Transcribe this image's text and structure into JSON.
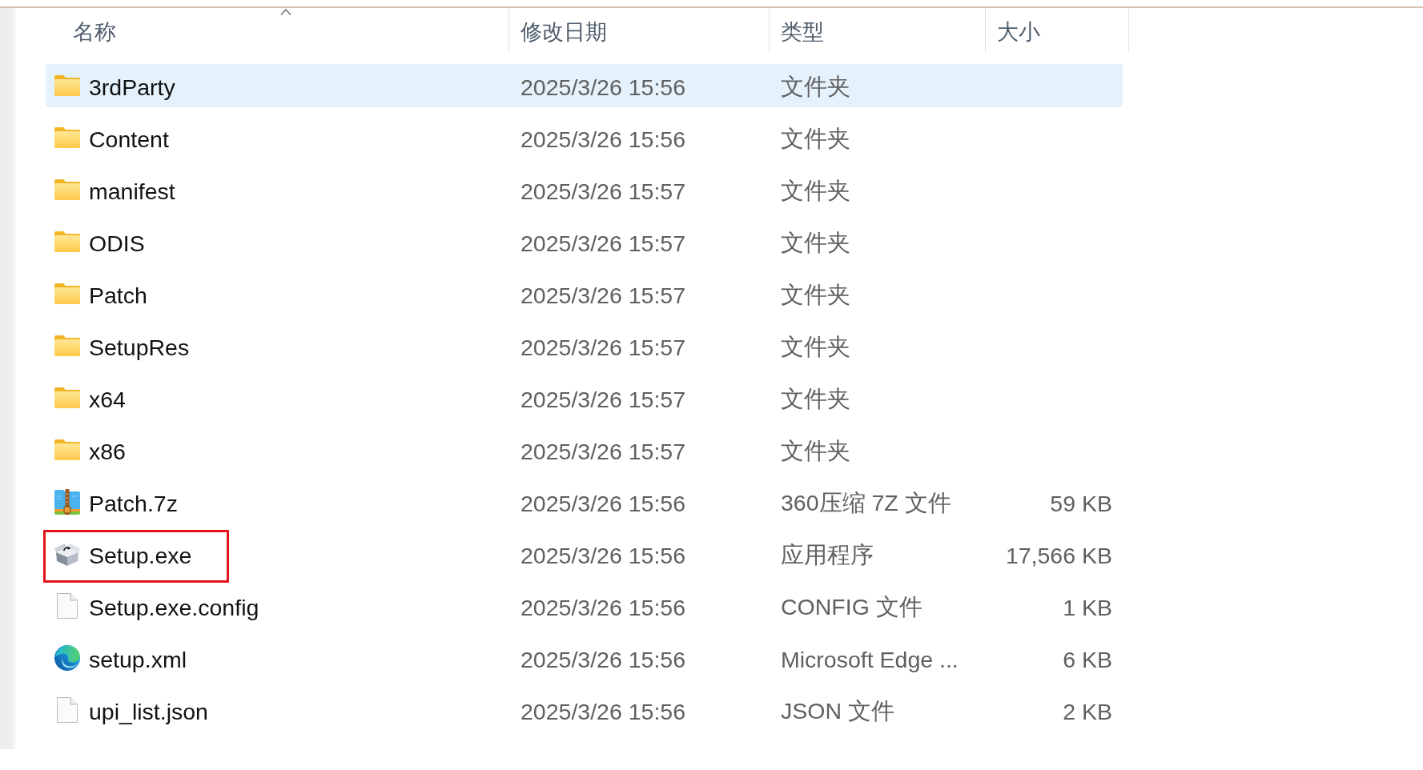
{
  "columns": [
    {
      "label": "名称",
      "sorted": true
    },
    {
      "label": "修改日期",
      "sorted": false
    },
    {
      "label": "类型",
      "sorted": false
    },
    {
      "label": "大小",
      "sorted": false
    }
  ],
  "files": [
    {
      "kind": "folder",
      "name": "3rdParty",
      "modified": "2025/3/26 15:56",
      "type": "文件夹",
      "selected": true,
      "highlighted": false
    },
    {
      "kind": "folder",
      "name": "Content",
      "modified": "2025/3/26 15:56",
      "type": "文件夹",
      "selected": false,
      "highlighted": false
    },
    {
      "kind": "folder",
      "name": "manifest",
      "modified": "2025/3/26 15:57",
      "type": "文件夹",
      "selected": false,
      "highlighted": false
    },
    {
      "kind": "folder",
      "name": "ODIS",
      "modified": "2025/3/26 15:57",
      "type": "文件夹",
      "selected": false,
      "highlighted": false
    },
    {
      "kind": "folder",
      "name": "Patch",
      "modified": "2025/3/26 15:57",
      "type": "文件夹",
      "selected": false,
      "highlighted": false
    },
    {
      "kind": "folder",
      "name": "SetupRes",
      "modified": "2025/3/26 15:57",
      "type": "文件夹",
      "selected": false,
      "highlighted": false
    },
    {
      "kind": "folder",
      "name": "x64",
      "modified": "2025/3/26 15:57",
      "type": "文件夹",
      "selected": false,
      "highlighted": false
    },
    {
      "kind": "folder",
      "name": "x86",
      "modified": "2025/3/26 15:57",
      "type": "文件夹",
      "selected": false,
      "highlighted": false
    },
    {
      "kind": "archive",
      "name": "Patch.7z",
      "modified": "2025/3/26 15:56",
      "type": "360压缩 7Z 文件",
      "size": "59 KB",
      "selected": false,
      "highlighted": false
    },
    {
      "kind": "installer",
      "name": "Setup.exe",
      "modified": "2025/3/26 15:56",
      "type": "应用程序",
      "size": "17,566 KB",
      "selected": false,
      "highlighted": true
    },
    {
      "kind": "document",
      "name": "Setup.exe.config",
      "modified": "2025/3/26 15:56",
      "type": "CONFIG 文件",
      "size": "1 KB",
      "selected": false,
      "highlighted": false
    },
    {
      "kind": "webpage",
      "name": "setup.xml",
      "modified": "2025/3/26 15:56",
      "type": "Microsoft Edge ...",
      "size": "6 KB",
      "selected": false,
      "highlighted": false
    },
    {
      "kind": "document",
      "name": "upi_list.json",
      "modified": "2025/3/26 15:56",
      "type": "JSON 文件",
      "size": "2 KB",
      "selected": false,
      "highlighted": false
    }
  ]
}
